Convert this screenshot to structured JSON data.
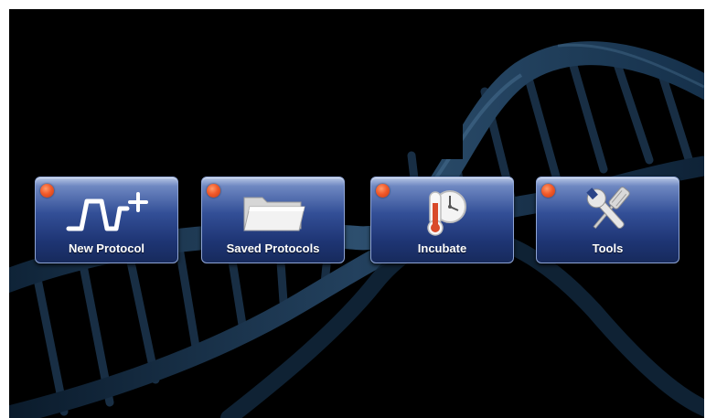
{
  "home_menu": {
    "tiles": [
      {
        "label": "New Protocol",
        "icon": "new-protocol-icon"
      },
      {
        "label": "Saved Protocols",
        "icon": "folder-icon"
      },
      {
        "label": "Incubate",
        "icon": "thermometer-clock-icon"
      },
      {
        "label": "Tools",
        "icon": "wrench-screwdriver-icon"
      }
    ],
    "status_led_color": "#f25a2a",
    "tile_color": "#2a4488",
    "background_color": "#000000",
    "background_motif": "dna-helix"
  }
}
